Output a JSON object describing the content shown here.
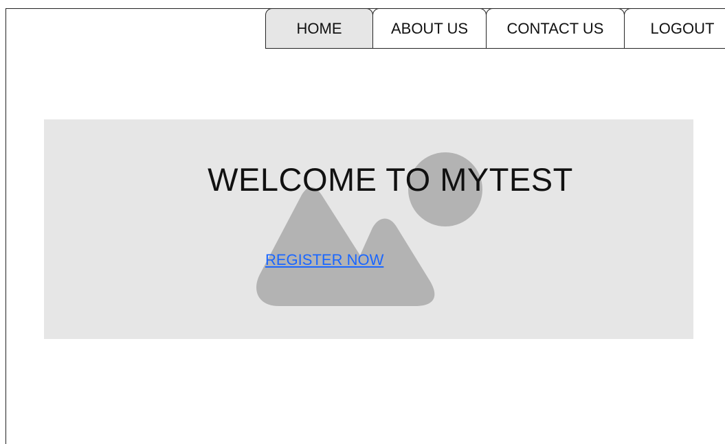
{
  "nav": {
    "tabs": [
      {
        "label": "HOME",
        "active": true
      },
      {
        "label": "ABOUT US",
        "active": false
      },
      {
        "label": "CONTACT US",
        "active": false
      },
      {
        "label": "LOGOUT",
        "active": false
      }
    ]
  },
  "hero": {
    "title": "WELCOME TO MYTEST",
    "register_link": "REGISTER NOW",
    "background_color": "#e6e6e6",
    "image_icon": "image-placeholder-icon"
  },
  "colors": {
    "link": "#1a66ff",
    "active_tab": "#e6e6e6",
    "placeholder_shape": "#b3b3b3"
  }
}
